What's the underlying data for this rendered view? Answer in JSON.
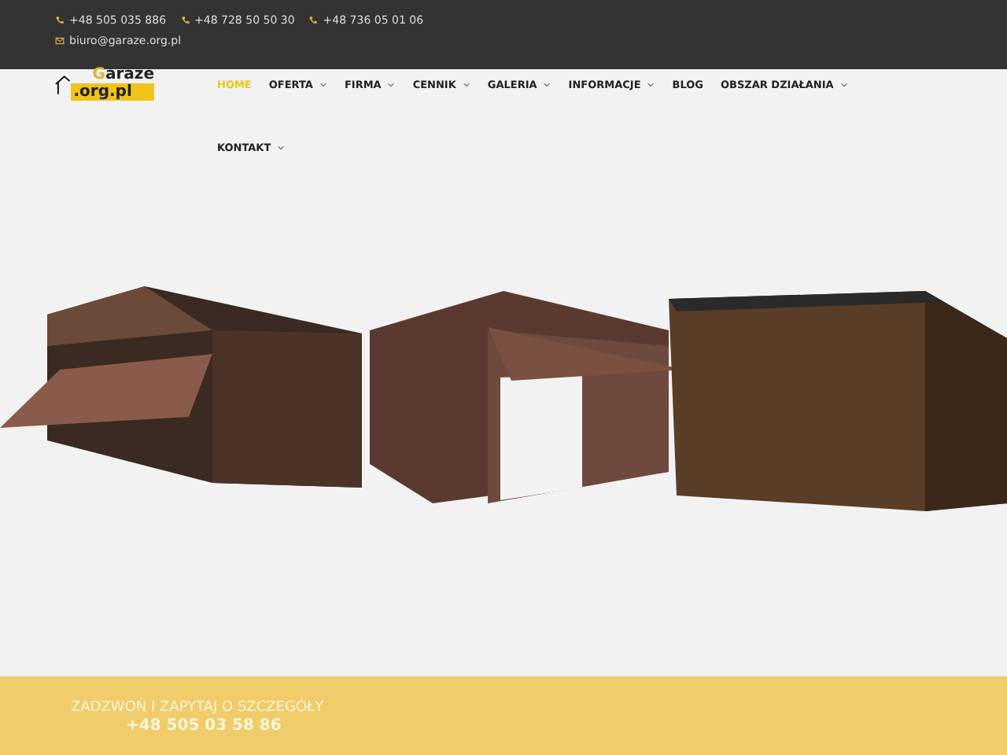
{
  "contacts": [
    {
      "kind": "phone",
      "text": "+48 505 035 886"
    },
    {
      "kind": "phone",
      "text": "+48 728 50 50 30"
    },
    {
      "kind": "phone",
      "text": "+48 736 05 01 06"
    },
    {
      "kind": "email",
      "text": "biuro@garaze.org.pl"
    }
  ],
  "logo": {
    "top": "Garaze",
    "bottom": ".org.pl"
  },
  "nav": [
    {
      "label": "HOME",
      "selected": true,
      "dropdown": false
    },
    {
      "label": "OFERTA",
      "selected": false,
      "dropdown": true
    },
    {
      "label": "FIRMA",
      "selected": false,
      "dropdown": true
    },
    {
      "label": "CENNIK",
      "selected": false,
      "dropdown": true
    },
    {
      "label": "GALERIA",
      "selected": false,
      "dropdown": true
    },
    {
      "label": "INFORMACJE",
      "selected": false,
      "dropdown": true
    },
    {
      "label": "BLOG",
      "selected": false,
      "dropdown": false
    },
    {
      "label": "OBSZAR DZIAŁANIA",
      "selected": false,
      "dropdown": true
    },
    {
      "label": "KONTAKT",
      "selected": false,
      "dropdown": true
    }
  ],
  "cta": {
    "heading": "ZADZWOŃ I ZAPYTAJ O SZCZEGÓŁY",
    "phone": "+48 505 03 58 86"
  }
}
